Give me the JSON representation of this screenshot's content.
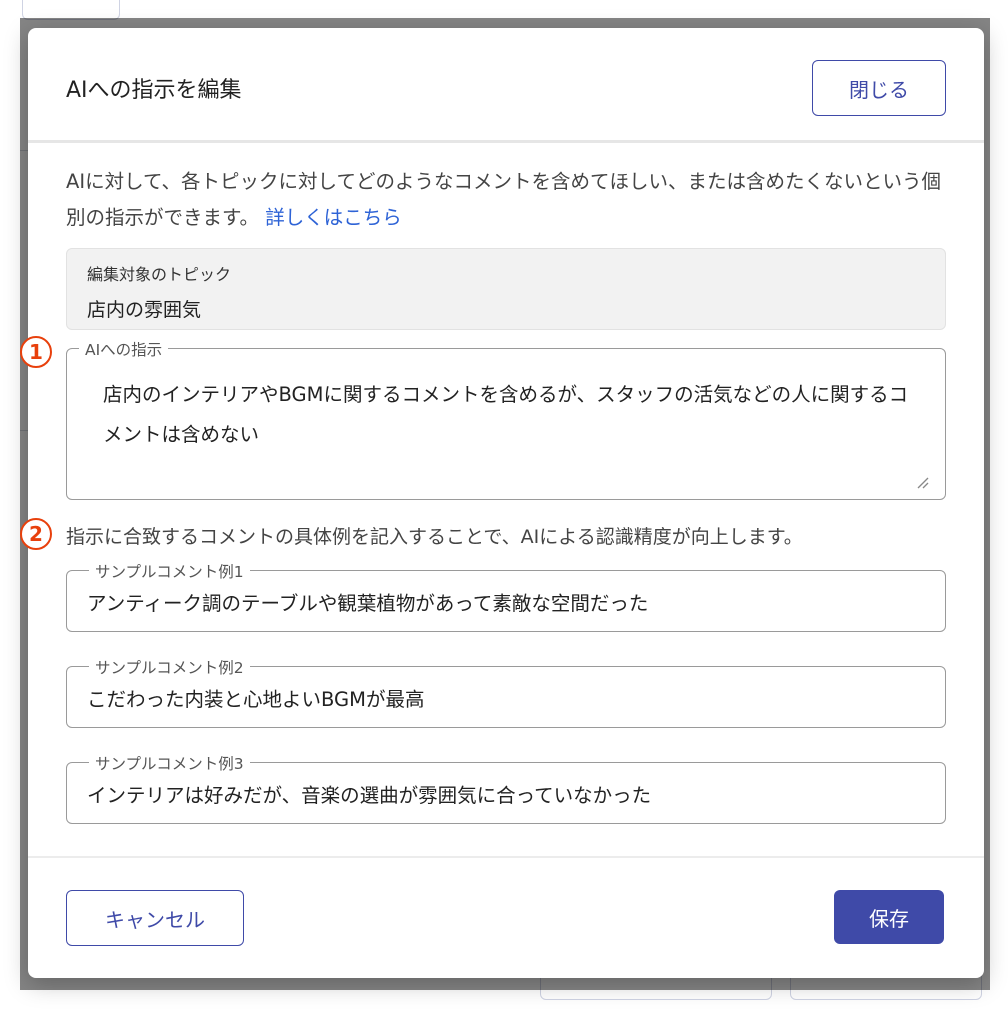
{
  "dialog": {
    "title": "AIへの指示を編集",
    "close_label": "閉じる",
    "description": "AIに対して、各トピックに対してどのようなコメントを含めてほしい、または含めたくないという個別の指示ができます。",
    "learn_more_link": "詳しくはこちら",
    "topic": {
      "label": "編集対象のトピック",
      "value": "店内の雰囲気"
    },
    "instruction": {
      "label": "AIへの指示",
      "value": "店内のインテリアやBGMに関するコメントを含めるが、スタッフの活気などの人に関するコメントは含めない"
    },
    "badges": [
      "1",
      "2"
    ],
    "hint": "指示に合致するコメントの具体例を記入することで、AIによる認識精度が向上します。",
    "samples": [
      {
        "label": "サンプルコメント例1",
        "value": "アンティーク調のテーブルや観葉植物があって素敵な空間だった"
      },
      {
        "label": "サンプルコメント例2",
        "value": "こだわった内装と心地よいBGMが最高"
      },
      {
        "label": "サンプルコメント例3",
        "value": "インテリアは好みだが、音楽の選曲が雰囲気に合っていなかった"
      }
    ],
    "cancel_label": "キャンセル",
    "save_label": "保存"
  },
  "colors": {
    "primary": "#3f4aa8",
    "link": "#2e63d6",
    "badge": "#e8400c",
    "overlay": "rgba(0,0,0,0.48)"
  }
}
